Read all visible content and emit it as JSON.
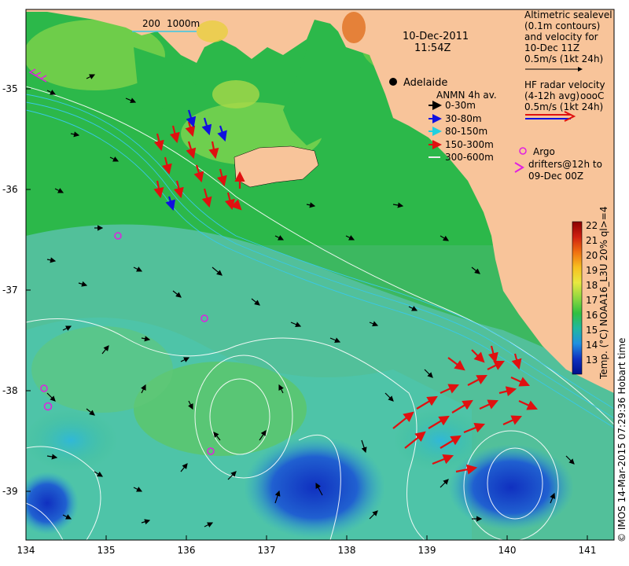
{
  "map": {
    "title_date": "10-Dec-2011",
    "title_time": "11:54Z",
    "city_label": "Adelaide",
    "scale_label": "200",
    "scale_label2": "1000m",
    "lon_ticks": [
      "134",
      "135",
      "136",
      "137",
      "138",
      "139",
      "140",
      "141"
    ],
    "lat_ticks": [
      "-35",
      "-36",
      "-37",
      "-38",
      "-39"
    ],
    "colors": {
      "land": "#f8c49a",
      "warm_water": "#22b84a",
      "mid_water": "#7fd24a",
      "cool_water": "#2fb8c0",
      "deep_blue": "#1540c0",
      "contour": "#ffffff",
      "bathy": "#39c8e8"
    },
    "legend_altimetry": {
      "line1": "Altimetric sealevel",
      "line2": "(0.1m contours)",
      "line3": "and velocity for",
      "line4": "10-Dec 11Z",
      "line5": "0.5m/s (1kt 24h)"
    },
    "legend_hf": {
      "line1": "HF radar velocity",
      "line2": "(4-12h avg)",
      "overlay": "oooC",
      "line3": "0.5m/s (1kt 24h)"
    },
    "legend_anmn": {
      "title": "ANMN 4h av.",
      "items": [
        {
          "label": "0-30m",
          "color": "#000000"
        },
        {
          "label": "30-80m",
          "color": "#1010e0"
        },
        {
          "label": "80-150m",
          "color": "#20d0e0"
        },
        {
          "label": "150-300m",
          "color": "#e01010"
        },
        {
          "label": "300-600m",
          "color": "#e8e8e8"
        }
      ]
    },
    "legend_argo": {
      "line1": "Argo",
      "line2": "drifters@12h to",
      "line3": "09-Dec 00Z"
    },
    "colorbar": {
      "ticks": [
        "22",
        "21",
        "20",
        "19",
        "18",
        "17",
        "16",
        "15",
        "14",
        "13"
      ],
      "label": "Temp. (°C) NOAA16_L3U 20% ql>=4",
      "stops": [
        "#8b0000",
        "#d02010",
        "#f07010",
        "#f8c020",
        "#e8e840",
        "#90d840",
        "#30c040",
        "#20b8a0",
        "#2090e0",
        "#1030c0",
        "#00108a"
      ]
    },
    "credit": "© IMOS 14-Mar-2015 07:29:36 Hobart time"
  }
}
